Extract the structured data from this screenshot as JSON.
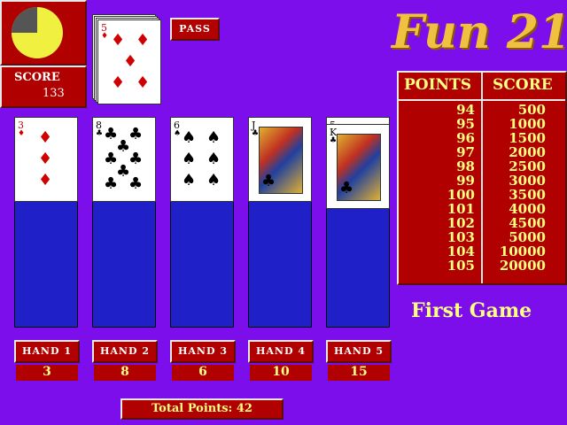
{
  "score_panel": {
    "label": "SCORE",
    "value": "133"
  },
  "pass_button": "PASS",
  "deck_top": {
    "rank": "5",
    "suit": "♦",
    "color": "red"
  },
  "title": "Fun 21",
  "table": {
    "headers": [
      "POINTS",
      "SCORE"
    ],
    "rows": [
      [
        "94",
        "500"
      ],
      [
        "95",
        "1000"
      ],
      [
        "96",
        "1500"
      ],
      [
        "97",
        "2000"
      ],
      [
        "98",
        "2500"
      ],
      [
        "99",
        "3000"
      ],
      [
        "100",
        "3500"
      ],
      [
        "101",
        "4000"
      ],
      [
        "102",
        "4500"
      ],
      [
        "103",
        "5000"
      ],
      [
        "104",
        "10000"
      ],
      [
        "105",
        "20000"
      ]
    ]
  },
  "status": "First Game",
  "hands": [
    {
      "label": "HAND 1",
      "total": "3",
      "cards": [
        {
          "rank": "3",
          "suit": "♦",
          "color": "red"
        }
      ]
    },
    {
      "label": "HAND 2",
      "total": "8",
      "cards": [
        {
          "rank": "8",
          "suit": "♣",
          "color": "black"
        }
      ]
    },
    {
      "label": "HAND 3",
      "total": "6",
      "cards": [
        {
          "rank": "6",
          "suit": "♠",
          "color": "black"
        }
      ]
    },
    {
      "label": "HAND 4",
      "total": "10",
      "cards": [
        {
          "rank": "J",
          "suit": "♣",
          "color": "black"
        }
      ]
    },
    {
      "label": "HAND 5",
      "total": "15",
      "cards": [
        {
          "rank": "5",
          "suit": "♣",
          "color": "black"
        },
        {
          "rank": "K",
          "suit": "♣",
          "color": "black"
        }
      ]
    }
  ],
  "total_points": "Total Points: 42",
  "timer_fraction": 0.75,
  "colors": {
    "background": "#7c0eec",
    "panel_red": "#b00000",
    "column_blue": "#2020c8",
    "title_gold": "#f0c040"
  }
}
